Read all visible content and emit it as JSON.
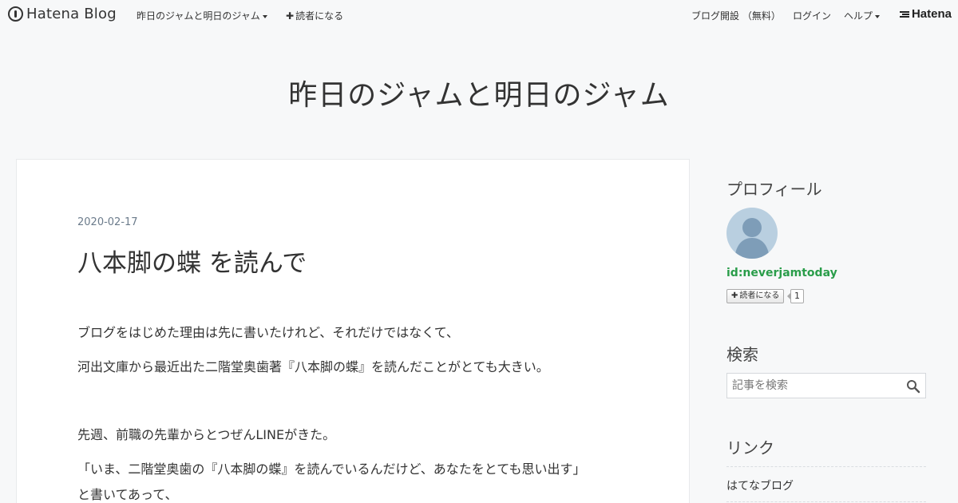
{
  "header": {
    "logo_text": "Hatena Blog",
    "blog_menu": "昨日のジャムと明日のジャム",
    "subscribe": "読者になる",
    "open_blog": "ブログ開設 （無料）",
    "login": "ログイン",
    "help": "ヘルプ",
    "hatena": "Hatena"
  },
  "blog": {
    "title": "昨日のジャムと明日のジャム"
  },
  "entry": {
    "date": "2020-02-17",
    "title": "八本脚の蝶 を読んで",
    "paragraphs": [
      "ブログをはじめた理由は先に書いたけれど、それだけではなくて、",
      "河出文庫から最近出た二階堂奥歯著『八本脚の蝶』を読んだことがとても大きい。",
      "先週、前職の先輩からとつぜんLINEがきた。",
      "「いま、二階堂奥歯の『八本脚の蝶』を読んでいるんだけど、あなたをとても思い出す」",
      "と書いてあって、"
    ]
  },
  "sidebar": {
    "profile_heading": "プロフィール",
    "profile_id": "id:neverjamtoday",
    "subscribe_label": "読者になる",
    "subscriber_count": "1",
    "search_heading": "検索",
    "search_placeholder": "記事を検索",
    "links_heading": "リンク",
    "links": [
      "はてなブログ"
    ]
  },
  "colors": {
    "background": "#f7f8f9",
    "profile_id": "#2a9d4a",
    "date": "#6b7b8b"
  },
  "icons": [
    "hatena-blog-logo-icon",
    "caret-down-icon",
    "plus-icon",
    "hatena-logo-icon",
    "avatar-placeholder-icon",
    "search-icon"
  ]
}
